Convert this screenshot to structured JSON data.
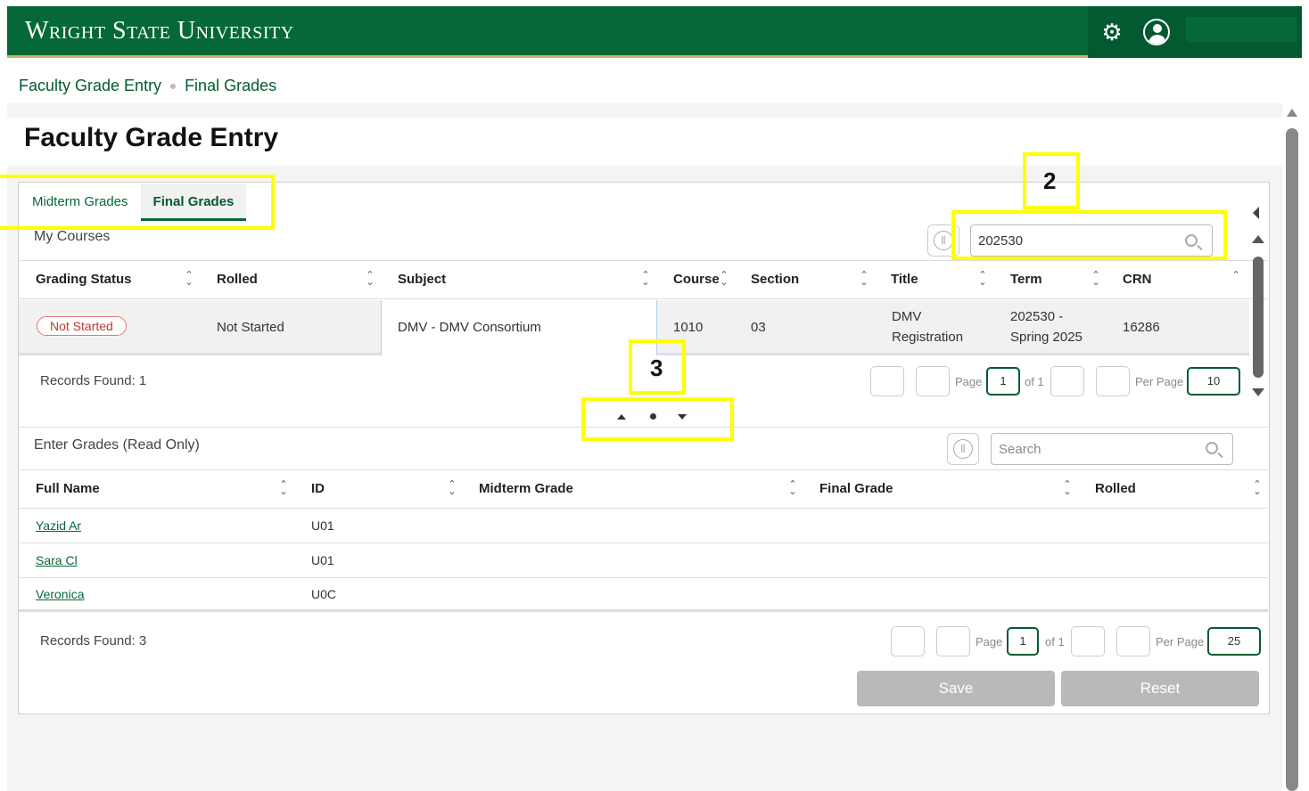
{
  "header": {
    "brand": "Wright State University",
    "icons": [
      "gear-icon",
      "user-icon"
    ]
  },
  "breadcrumb": {
    "items": [
      "Faculty Grade Entry",
      "Final Grades"
    ]
  },
  "page": {
    "title": "Faculty Grade Entry"
  },
  "tabs": [
    {
      "label": "Midterm Grades",
      "active": false
    },
    {
      "label": "Final Grades",
      "active": true
    }
  ],
  "courses": {
    "label": "My Courses",
    "search_value": "202530",
    "columns": [
      "Grading Status",
      "Rolled",
      "Subject",
      "Course",
      "Section",
      "Title",
      "Term",
      "CRN"
    ],
    "rows": [
      {
        "grading_status": "Not Started",
        "rolled": "Not Started",
        "subject": "DMV - DMV Consortium",
        "course": "1010",
        "section": "03",
        "title_line1": "DMV",
        "title_line2": "Registration",
        "term_line1": "202530 -",
        "term_line2": "Spring 2025",
        "crn": "16286"
      }
    ],
    "records_found": "Records Found: 1",
    "pagination": {
      "page_label": "Page",
      "page": "1",
      "of_label": "of 1",
      "per_page_label": "Per Page",
      "per_page": "10"
    }
  },
  "grades": {
    "label": "Enter Grades (Read Only)",
    "search_placeholder": "Search",
    "columns": [
      "Full Name",
      "ID",
      "Midterm Grade",
      "Final Grade",
      "Rolled"
    ],
    "rows": [
      {
        "name": "Yazid Ar",
        "id": "U01"
      },
      {
        "name": "Sara Cl",
        "id": "U01"
      },
      {
        "name": "Veronica",
        "id": "U0C"
      }
    ],
    "records_found": "Records Found: 3",
    "pagination": {
      "page_label": "Page",
      "page": "1",
      "of_label": "of 1",
      "per_page_label": "Per Page",
      "per_page": "25"
    },
    "save_label": "Save",
    "reset_label": "Reset"
  },
  "annotations": {
    "label_2": "2",
    "label_3": "3",
    "color": "#ffff00"
  },
  "colors": {
    "brand_green": "#066839",
    "accent_gold": "#c9b16b",
    "status_red": "#c0392b",
    "disabled_button": "#b9b9b9"
  }
}
